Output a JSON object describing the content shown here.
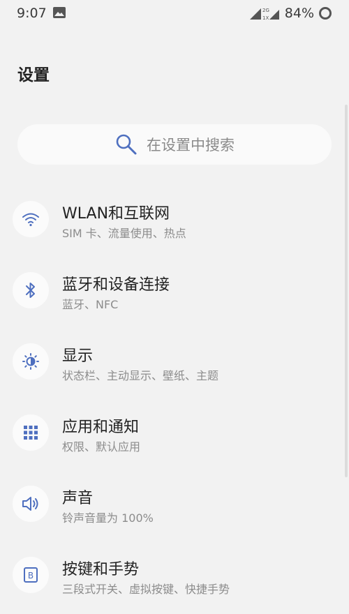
{
  "status_bar": {
    "time": "9:07",
    "network_label_top": "2G",
    "network_label_bottom": "1X",
    "battery_percent": "84%"
  },
  "header": {
    "title": "设置"
  },
  "search": {
    "placeholder": "在设置中搜索"
  },
  "settings": {
    "items": [
      {
        "title": "WLAN和互联网",
        "subtitle": "SIM 卡、流量使用、热点",
        "icon": "wifi-icon"
      },
      {
        "title": "蓝牙和设备连接",
        "subtitle": "蓝牙、NFC",
        "icon": "bluetooth-icon"
      },
      {
        "title": "显示",
        "subtitle": "状态栏、主动显示、壁纸、主题",
        "icon": "brightness-icon"
      },
      {
        "title": "应用和通知",
        "subtitle": "权限、默认应用",
        "icon": "apps-grid-icon"
      },
      {
        "title": "声音",
        "subtitle": "铃声音量为 100%",
        "icon": "speaker-icon"
      },
      {
        "title": "按键和手势",
        "subtitle": "三段式开关、虚拟按键、快捷手势",
        "icon": "buttons-icon"
      }
    ]
  },
  "colors": {
    "accent": "#4e6fbf",
    "background": "#f2f2f2"
  }
}
